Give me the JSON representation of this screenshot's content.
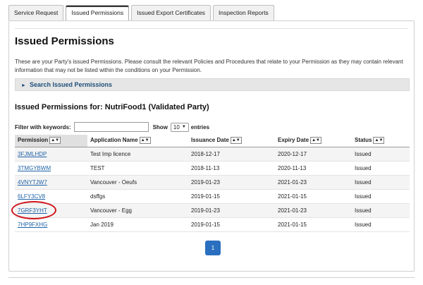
{
  "tabs": [
    {
      "label": "Service Request",
      "active": false
    },
    {
      "label": "Issued Permissions",
      "active": true
    },
    {
      "label": "Issued Export Certificates",
      "active": false
    },
    {
      "label": "Inspection Reports",
      "active": false
    }
  ],
  "page": {
    "title": "Issued Permissions",
    "intro": "These are your Party's issued Permissions. Please consult the relevant Policies and Procedures that relate to your Permission as they may contain relevant information that may not be listed within the conditions on your Permission.",
    "search_toggle": "Search Issued Permissions",
    "section_title": "Issued Permissions for: NutriFood1 (Validated Party)"
  },
  "filter": {
    "label": "Filter with keywords:",
    "value": "",
    "show_label": "Show",
    "entries_value": "10",
    "entries_label": "entries"
  },
  "table": {
    "columns": [
      "Permission",
      "Application Name",
      "Issuance Date",
      "Expiry Date",
      "Status"
    ],
    "rows": [
      [
        "3FJMLHDP",
        "Test Imp licence",
        "2018-12-17",
        "2020-12-17",
        "Issued"
      ],
      [
        "3TMGYBWM",
        "TEST",
        "2018-11-13",
        "2020-11-13",
        "Issued"
      ],
      [
        "4VNYTJW7",
        "Vancouver - Oeufs",
        "2019-01-23",
        "2021-01-23",
        "Issued"
      ],
      [
        "6LFY3CV8",
        "dsffgs",
        "2019-01-15",
        "2021-01-15",
        "Issued"
      ],
      [
        "7GRF3YHT",
        "Vancouver - Egg",
        "2019-01-23",
        "2021-01-23",
        "Issued"
      ],
      [
        "7HP9FXHG",
        "Jan 2019",
        "2019-01-15",
        "2021-01-15",
        "Issued"
      ]
    ]
  },
  "pagination": {
    "current": "1"
  },
  "colors": {
    "link": "#1f63a8",
    "highlight": "#d0131a",
    "pager": "#2a6fc0"
  },
  "icons": {
    "sort": "sort-up-down-icon",
    "expand": "triangle-right-icon",
    "dropdown": "chevron-down-icon"
  }
}
